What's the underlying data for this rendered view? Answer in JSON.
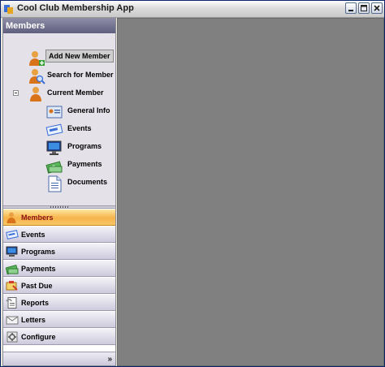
{
  "window": {
    "title": "Cool Club Membership App"
  },
  "nav": {
    "header": "Members",
    "tree": [
      {
        "label": "Add New Member",
        "icon": "person-add-icon",
        "selected": true
      },
      {
        "label": "Search for Member",
        "icon": "person-search-icon"
      },
      {
        "label": "Current Member",
        "icon": "person-icon",
        "expanded": true
      },
      {
        "label": "General Info",
        "icon": "id-card-icon"
      },
      {
        "label": "Events",
        "icon": "ticket-icon"
      },
      {
        "label": "Programs",
        "icon": "monitor-icon"
      },
      {
        "label": "Payments",
        "icon": "money-icon"
      },
      {
        "label": "Documents",
        "icon": "document-icon"
      }
    ],
    "panes": [
      {
        "label": "Members",
        "icon": "person-icon",
        "active": true
      },
      {
        "label": "Events",
        "icon": "ticket-icon"
      },
      {
        "label": "Programs",
        "icon": "monitor-icon"
      },
      {
        "label": "Payments",
        "icon": "money-icon"
      },
      {
        "label": "Past Due",
        "icon": "past-due-icon"
      },
      {
        "label": "Reports",
        "icon": "report-icon"
      },
      {
        "label": "Letters",
        "icon": "envelope-icon"
      },
      {
        "label": "Configure",
        "icon": "configure-icon"
      }
    ],
    "footer_glyph": "»"
  },
  "colors": {
    "active_pane": "#f7b44a",
    "active_label": "#8a1010",
    "content_bg": "#808080",
    "tree_bg": "#e4e1e9"
  }
}
